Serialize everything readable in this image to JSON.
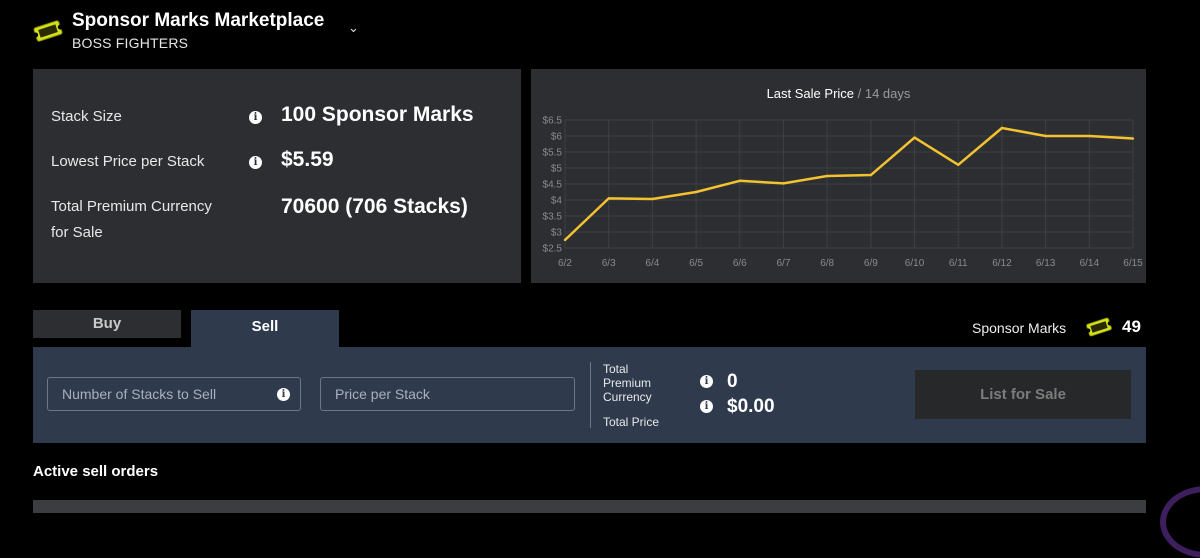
{
  "header": {
    "title": "Sponsor Marks Marketplace",
    "subtitle": "BOSS FIGHTERS",
    "chevron": "⌄"
  },
  "info": {
    "rows": [
      {
        "label": "Stack Size",
        "value": "100 Sponsor Marks",
        "has_info": true
      },
      {
        "label": "Lowest Price per Stack",
        "value": "$5.59",
        "has_info": true
      },
      {
        "label_line1": "Total Premium Currency",
        "label_line2": "for Sale",
        "value": "70600 (706 Stacks)",
        "has_info": false
      }
    ]
  },
  "chart": {
    "title": "Last Sale Price",
    "subtitle": "/ 14 days"
  },
  "chart_data": {
    "type": "line",
    "title": "Last Sale Price",
    "subtitle": "/ 14 days",
    "categories": [
      "6/2",
      "6/3",
      "6/4",
      "6/5",
      "6/6",
      "6/7",
      "6/8",
      "6/9",
      "6/10",
      "6/11",
      "6/12",
      "6/13",
      "6/14",
      "6/15"
    ],
    "series": [
      {
        "values": [
          2.75,
          4.05,
          4.03,
          4.25,
          4.6,
          4.52,
          4.75,
          4.78,
          5.95,
          5.1,
          6.25,
          6.0,
          6.0,
          5.92
        ],
        "color": "#f2c230"
      }
    ],
    "yticks": [
      "$2.5",
      "$3",
      "$3.5",
      "$4",
      "$4.5",
      "$5",
      "$5.5",
      "$6",
      "$6.5"
    ],
    "ylim": [
      2.5,
      6.5
    ],
    "grid": true,
    "legend": "none"
  },
  "tabs": {
    "buy": "Buy",
    "sell": "Sell",
    "active": "sell"
  },
  "balance": {
    "label": "Sponsor Marks",
    "value": "49"
  },
  "sell_form": {
    "stacks_placeholder": "Number of Stacks to Sell",
    "price_placeholder": "Price per Stack",
    "total_currency_label_1": "Total",
    "total_currency_label_2": "Premium",
    "total_currency_label_3": "Currency",
    "total_currency_value": "0",
    "total_price_label": "Total Price",
    "total_price_value": "$0.00",
    "submit_label": "List for Sale"
  },
  "orders": {
    "heading": "Active sell orders"
  },
  "colors": {
    "background": "#000000",
    "panel": "#2c2e31",
    "sell_panel": "#2f3a4d",
    "accent_line": "#f2c230",
    "ticket": "#d4e01a"
  },
  "icons": {
    "ticket": "sponsor-mark-ticket-icon",
    "info": "info-icon",
    "chevron": "chevron-down-icon"
  }
}
